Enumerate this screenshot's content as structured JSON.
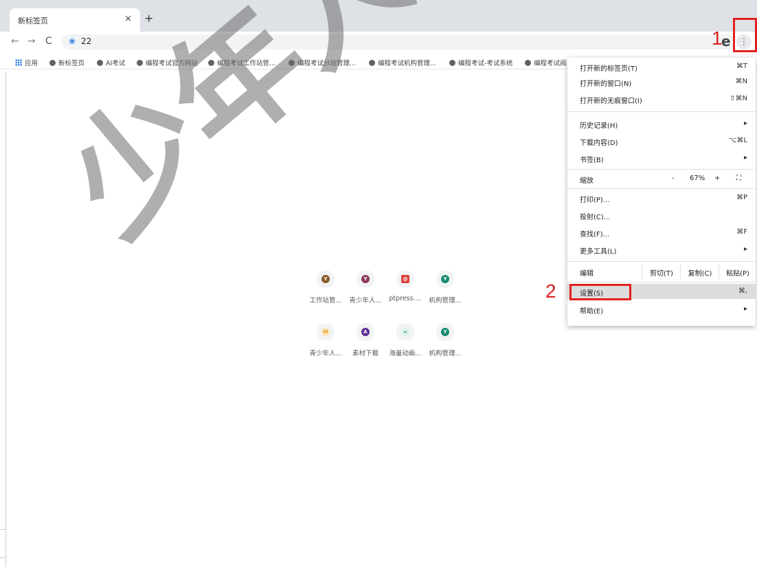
{
  "tab": {
    "title": "新标签页",
    "close": "×",
    "new": "+"
  },
  "toolbar": {
    "back": "←",
    "forward": "→",
    "reload": "C",
    "url": "22",
    "profile_letter": "e",
    "menu_icon": "⋮"
  },
  "bookmarks": [
    {
      "label": "应用",
      "type": "apps"
    },
    {
      "label": "新标签页"
    },
    {
      "label": "AI考试"
    },
    {
      "label": "编程考试官方网站"
    },
    {
      "label": "编程考试工作站管..."
    },
    {
      "label": "编程考试分站管理..."
    },
    {
      "label": "编程考试机构管理..."
    },
    {
      "label": "编程考试-考试系统"
    },
    {
      "label": "编程考试阅"
    }
  ],
  "shortcuts": [
    {
      "label": "工作站管...",
      "letter": "Y",
      "color": "#8a5a2b"
    },
    {
      "label": "青少年人...",
      "letter": "Y",
      "color": "#8b3a5a"
    },
    {
      "label": "ptpress....",
      "letter": "@",
      "color": "#d9423a"
    },
    {
      "label": "机构管理...",
      "letter": "Y",
      "color": "#178a6e"
    },
    {
      "label": "青少年人...",
      "letter": "M",
      "color": "#f2c15c"
    },
    {
      "label": "素材下载",
      "letter": "A",
      "color": "#5b2d91"
    },
    {
      "label": "海量动画...",
      "letter": "≈",
      "color": "#7fc7a8"
    },
    {
      "label": "机构管理...",
      "letter": "Y",
      "color": "#178a6e"
    }
  ],
  "menu": {
    "new_tab": "打开新的标签页(T)",
    "new_tab_sc": "⌘T",
    "new_window": "打开新的窗口(N)",
    "new_window_sc": "⌘N",
    "incognito": "打开新的无痕窗口(I)",
    "incognito_sc": "⇧⌘N",
    "history": "历史记录(H)",
    "history_sc": "▸",
    "downloads": "下载内容(D)",
    "downloads_sc": "⌥⌘L",
    "bookmarks": "书签(B)",
    "bookmarks_sc": "▸",
    "zoom": "缩放",
    "zoom_minus": "-",
    "zoom_value": "67%",
    "zoom_plus": "+",
    "fullscreen": "⛶",
    "print": "打印(P)...",
    "print_sc": "⌘P",
    "cast": "投射(C)...",
    "find": "查找(F)...",
    "find_sc": "⌘F",
    "more_tools": "更多工具(L)",
    "more_tools_sc": "▸",
    "edit": "编辑",
    "cut": "剪切(T)",
    "copy": "复制(C)",
    "paste": "粘贴(P)",
    "settings": "设置(S)",
    "settings_sc": "⌘,",
    "help": "帮助(E)",
    "help_sc": "▸"
  },
  "annotations": {
    "step1": "1",
    "step2": "2"
  },
  "watermark": "少年人工智",
  "colors": {
    "highlight": "#e0211e",
    "menu_hover": "#dddddd"
  }
}
